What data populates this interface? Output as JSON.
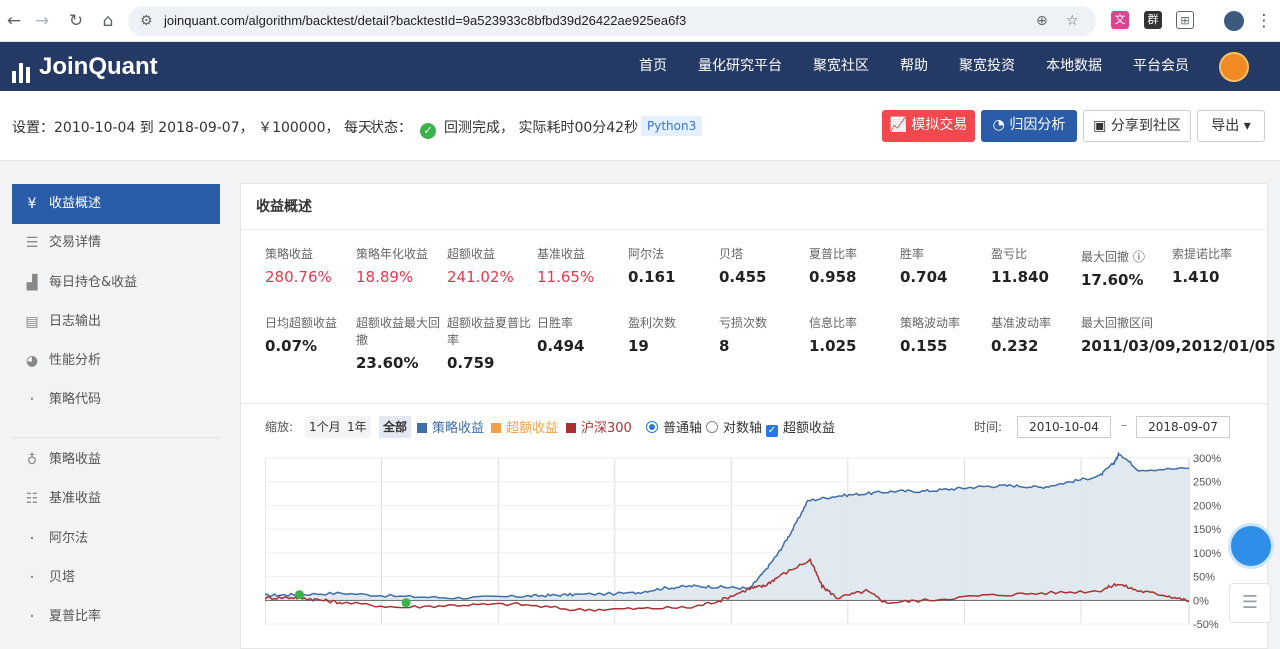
{
  "browser": {
    "url": "joinquant.com/algorithm/backtest/detail?backtestId=9a523933c8bfbd39d26422ae925ea6f3"
  },
  "nav": {
    "logo": "JoinQuant",
    "items": [
      "首页",
      "量化研究平台",
      "聚宽社区",
      "帮助",
      "聚宽投资",
      "本地数据",
      "平台会员"
    ]
  },
  "settings": {
    "label": "设置：",
    "value": "2010-10-04 到 2018-09-07， ￥100000， 每天",
    "status_label": "状态：",
    "status": "回测完成， 实际耗时00分42秒",
    "python": "Python3"
  },
  "actions": {
    "simulate": "模拟交易",
    "attribution": "归因分析",
    "share": "分享到社区",
    "export": "导出"
  },
  "sidebar": {
    "items": [
      {
        "label": "收益概述",
        "icon": "yen-icon",
        "active": true
      },
      {
        "label": "交易详情",
        "icon": "list-icon"
      },
      {
        "label": "每日持仓&收益",
        "icon": "chart-icon"
      },
      {
        "label": "日志输出",
        "icon": "calendar-icon"
      },
      {
        "label": "性能分析",
        "icon": "pie-icon"
      },
      {
        "label": "策略代码",
        "icon": "dot-icon"
      },
      {
        "label": "策略收益",
        "icon": "bulb-icon"
      },
      {
        "label": "基准收益",
        "icon": "database-icon"
      },
      {
        "label": "阿尔法",
        "icon": "dot-icon"
      },
      {
        "label": "贝塔",
        "icon": "dot-icon"
      },
      {
        "label": "夏普比率",
        "icon": "dot-icon"
      }
    ]
  },
  "panel": {
    "title": "收益概述"
  },
  "metrics": [
    {
      "label": "策略收益",
      "value": "280.76%",
      "red": true
    },
    {
      "label": "策略年化收益",
      "value": "18.89%",
      "red": true
    },
    {
      "label": "超额收益",
      "value": "241.02%",
      "red": true
    },
    {
      "label": "基准收益",
      "value": "11.65%",
      "red": true
    },
    {
      "label": "阿尔法",
      "value": "0.161"
    },
    {
      "label": "贝塔",
      "value": "0.455"
    },
    {
      "label": "夏普比率",
      "value": "0.958"
    },
    {
      "label": "胜率",
      "value": "0.704"
    },
    {
      "label": "盈亏比",
      "value": "11.840"
    },
    {
      "label": "最大回撤",
      "value": "17.60%",
      "help": true
    },
    {
      "label": "索提诺比率",
      "value": "1.410"
    },
    {
      "label": "日均超额收益",
      "value": "0.07%"
    },
    {
      "label": "超额收益最大回撤",
      "value": "23.60%"
    },
    {
      "label": "超额收益夏普比率",
      "value": "0.759"
    },
    {
      "label": "日胜率",
      "value": "0.494"
    },
    {
      "label": "盈利次数",
      "value": "19"
    },
    {
      "label": "亏损次数",
      "value": "8"
    },
    {
      "label": "信息比率",
      "value": "1.025"
    },
    {
      "label": "策略波动率",
      "value": "0.155"
    },
    {
      "label": "基准波动率",
      "value": "0.232"
    },
    {
      "label": "最大回撤区间",
      "value": "2011/03/09,2012/01/05"
    }
  ],
  "chart_controls": {
    "zoom_label": "缩放:",
    "zoom": [
      "1个月",
      "1年",
      "全部"
    ],
    "zoom_active": "全部",
    "legend": [
      {
        "name": "策略收益",
        "color": "#3f6ea6"
      },
      {
        "name": "超额收益",
        "color": "#f5a04a"
      },
      {
        "name": "沪深300",
        "color": "#a83232"
      }
    ],
    "axis_normal": "普通轴",
    "axis_log": "对数轴",
    "excess_toggle": "超额收益",
    "time_label": "时间:",
    "date_from": "2010-10-04",
    "date_to": "2018-09-07",
    "dash": "–"
  },
  "chart_data": {
    "type": "area",
    "xlim": [
      "2010-10-04",
      "2018-09-07"
    ],
    "ylim": [
      -50,
      300
    ],
    "y_ticks": [
      "300%",
      "250%",
      "200%",
      "150%",
      "100%",
      "50%",
      "0%",
      "-50%"
    ],
    "series": [
      {
        "name": "策略收益",
        "color": "#3f6ea6",
        "fill": "#dde5ee",
        "x": [
          "2010-10-04",
          "2011-01-01",
          "2011-06-01",
          "2011-12-01",
          "2012-06-01",
          "2012-12-01",
          "2013-03-01",
          "2013-06-01",
          "2013-12-01",
          "2014-03-01",
          "2014-06-01",
          "2014-09-01",
          "2014-12-01",
          "2015-01-15",
          "2015-03-01",
          "2015-04-15",
          "2015-06-01",
          "2015-09-01",
          "2015-12-01",
          "2016-03-01",
          "2016-06-01",
          "2016-09-01",
          "2016-12-01",
          "2017-03-01",
          "2017-06-01",
          "2017-09-01",
          "2017-12-01",
          "2018-01-15",
          "2018-02-01",
          "2018-04-01",
          "2018-09-07"
        ],
        "values": [
          10,
          12,
          15,
          8,
          5,
          8,
          10,
          12,
          15,
          25,
          30,
          28,
          25,
          60,
          100,
          150,
          210,
          220,
          225,
          230,
          230,
          235,
          240,
          242,
          238,
          250,
          262,
          290,
          310,
          275,
          278
        ]
      },
      {
        "name": "沪深300",
        "color": "#a83232",
        "x": [
          "2010-10-04",
          "2011-01-01",
          "2011-03-09",
          "2011-06-01",
          "2011-12-01",
          "2012-06-01",
          "2012-12-01",
          "2013-06-01",
          "2013-12-01",
          "2014-06-01",
          "2014-09-01",
          "2014-12-01",
          "2015-01-15",
          "2015-03-01",
          "2015-06-08",
          "2015-07-15",
          "2015-09-01",
          "2015-12-01",
          "2016-02-01",
          "2016-06-01",
          "2016-12-01",
          "2017-06-01",
          "2017-12-01",
          "2018-01-26",
          "2018-04-01",
          "2018-07-01",
          "2018-09-07"
        ],
        "values": [
          5,
          6,
          2,
          -5,
          -15,
          -10,
          -8,
          -20,
          -18,
          -15,
          0,
          25,
          30,
          50,
          85,
          30,
          5,
          20,
          -5,
          0,
          10,
          15,
          20,
          35,
          20,
          10,
          -2
        ]
      }
    ],
    "markers": [
      {
        "date": "2011-01-20",
        "value": 12,
        "color": "#3bb34a"
      },
      {
        "date": "2011-12-20",
        "value": -5,
        "color": "#3bb34a"
      }
    ]
  }
}
